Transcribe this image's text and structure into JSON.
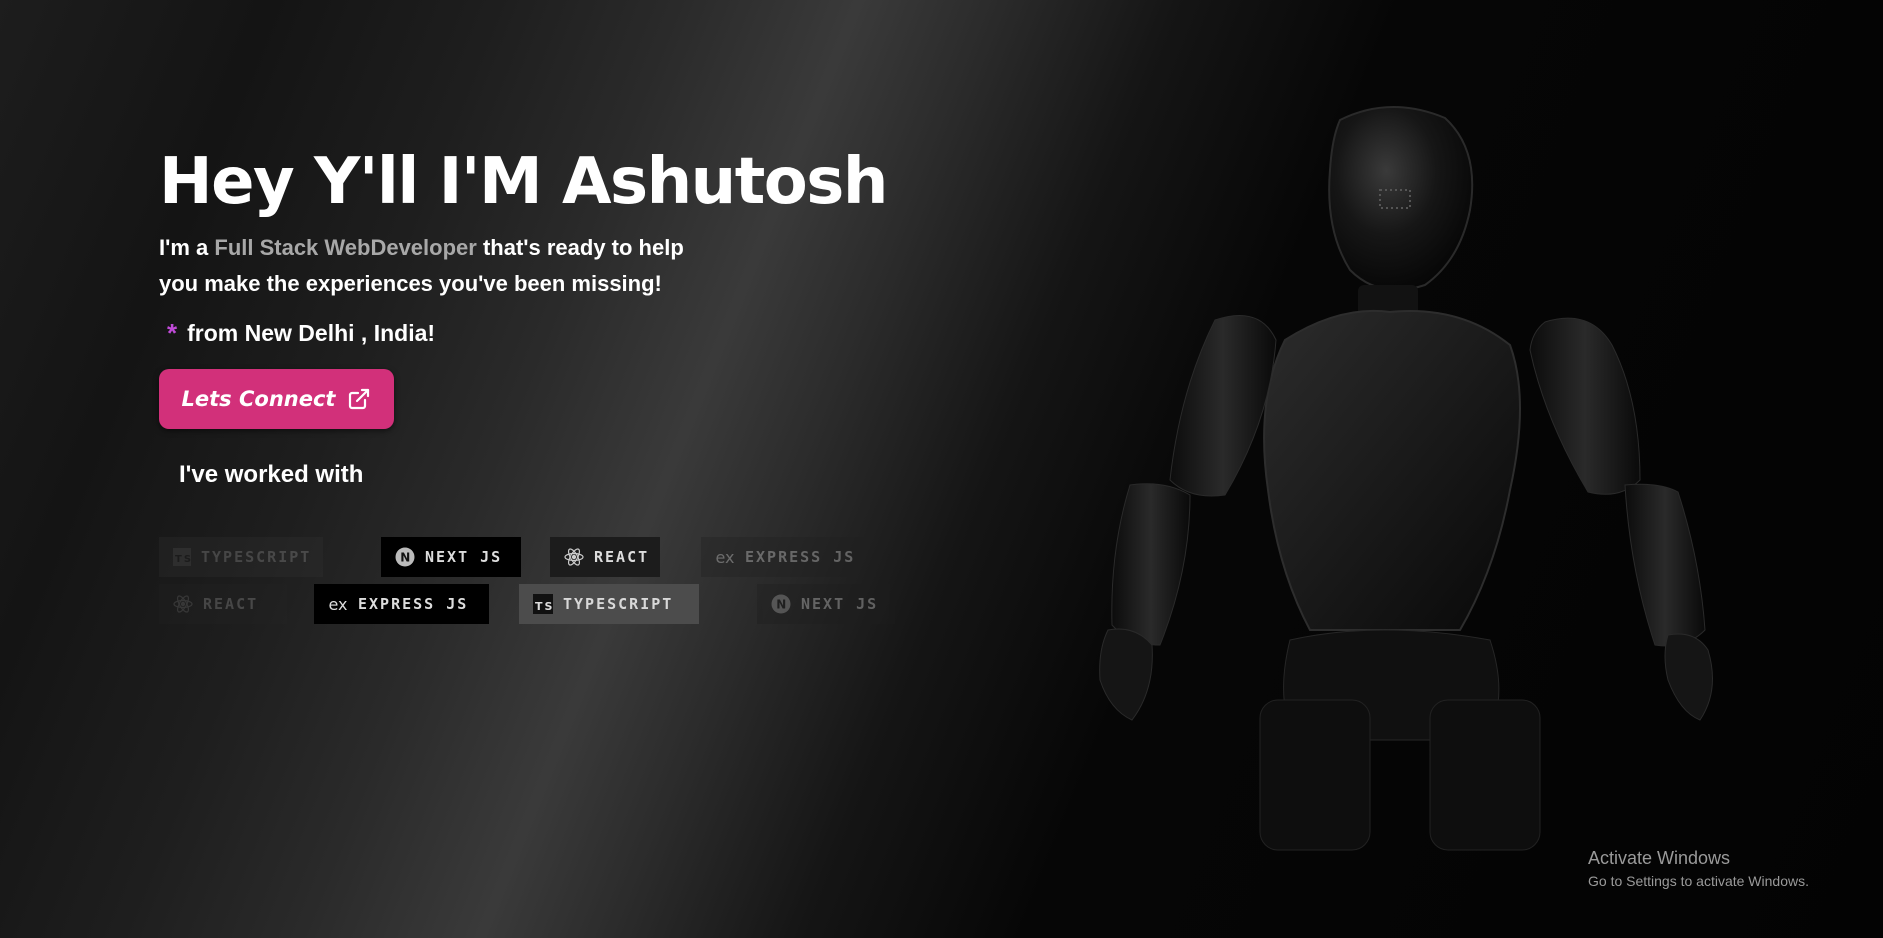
{
  "hero": {
    "title": "Hey Y'll I'M Ashutosh",
    "intro_prefix": "I'm a ",
    "intro_accent": "Full Stack WebDeveloper",
    "intro_suffix": " that's ready to help you make the experiences you've been missing!",
    "location_star": "*",
    "location": "from New Delhi , India!",
    "cta_label": "Lets Connect",
    "cta_icon": "external-link-icon",
    "worked_heading": "I've worked with"
  },
  "tech_row_1": [
    {
      "label": "TYPESCRIPT",
      "icon": "typescript-icon"
    },
    {
      "label": "NEXT JS",
      "icon": "nextjs-icon"
    },
    {
      "label": "REACT",
      "icon": "react-icon"
    },
    {
      "label": "EXPRESS JS",
      "icon": "express-icon"
    }
  ],
  "tech_row_2": [
    {
      "label": "REACT",
      "icon": "react-icon"
    },
    {
      "label": "EXPRESS JS",
      "icon": "express-icon"
    },
    {
      "label": "TYPESCRIPT",
      "icon": "typescript-icon"
    },
    {
      "label": "NEXT JS",
      "icon": "nextjs-icon"
    }
  ],
  "watermark": {
    "line1": "Activate Windows",
    "line2": "Go to Settings to activate Windows."
  },
  "colors": {
    "accent": "#d2307a",
    "star": "#c04bd8",
    "intro_accent": "#a8a8a8"
  }
}
